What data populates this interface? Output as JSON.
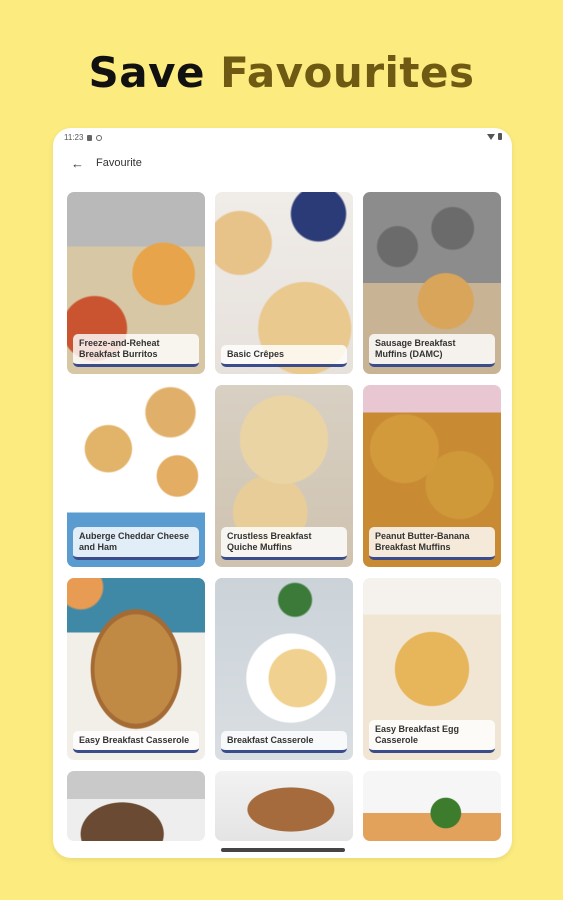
{
  "headline": {
    "word1": "Save",
    "word2": "Favourites"
  },
  "status_bar": {
    "time": "11:23"
  },
  "app_bar": {
    "title": "Favourite"
  },
  "recipes": [
    {
      "title": "Freeze-and-Reheat Breakfast Burritos"
    },
    {
      "title": "Basic Crêpes"
    },
    {
      "title": "Sausage Breakfast Muffins (DAMC)"
    },
    {
      "title": "Auberge Cheddar Cheese and Ham"
    },
    {
      "title": "Crustless Breakfast Quiche Muffins"
    },
    {
      "title": "Peanut Butter-Banana Breakfast Muffins"
    },
    {
      "title": "Easy Breakfast Casserole"
    },
    {
      "title": "Breakfast Casserole"
    },
    {
      "title": "Easy Breakfast Egg Casserole"
    }
  ],
  "colors": {
    "background": "#FCEB7F",
    "accent_word": "#6E5A12"
  }
}
